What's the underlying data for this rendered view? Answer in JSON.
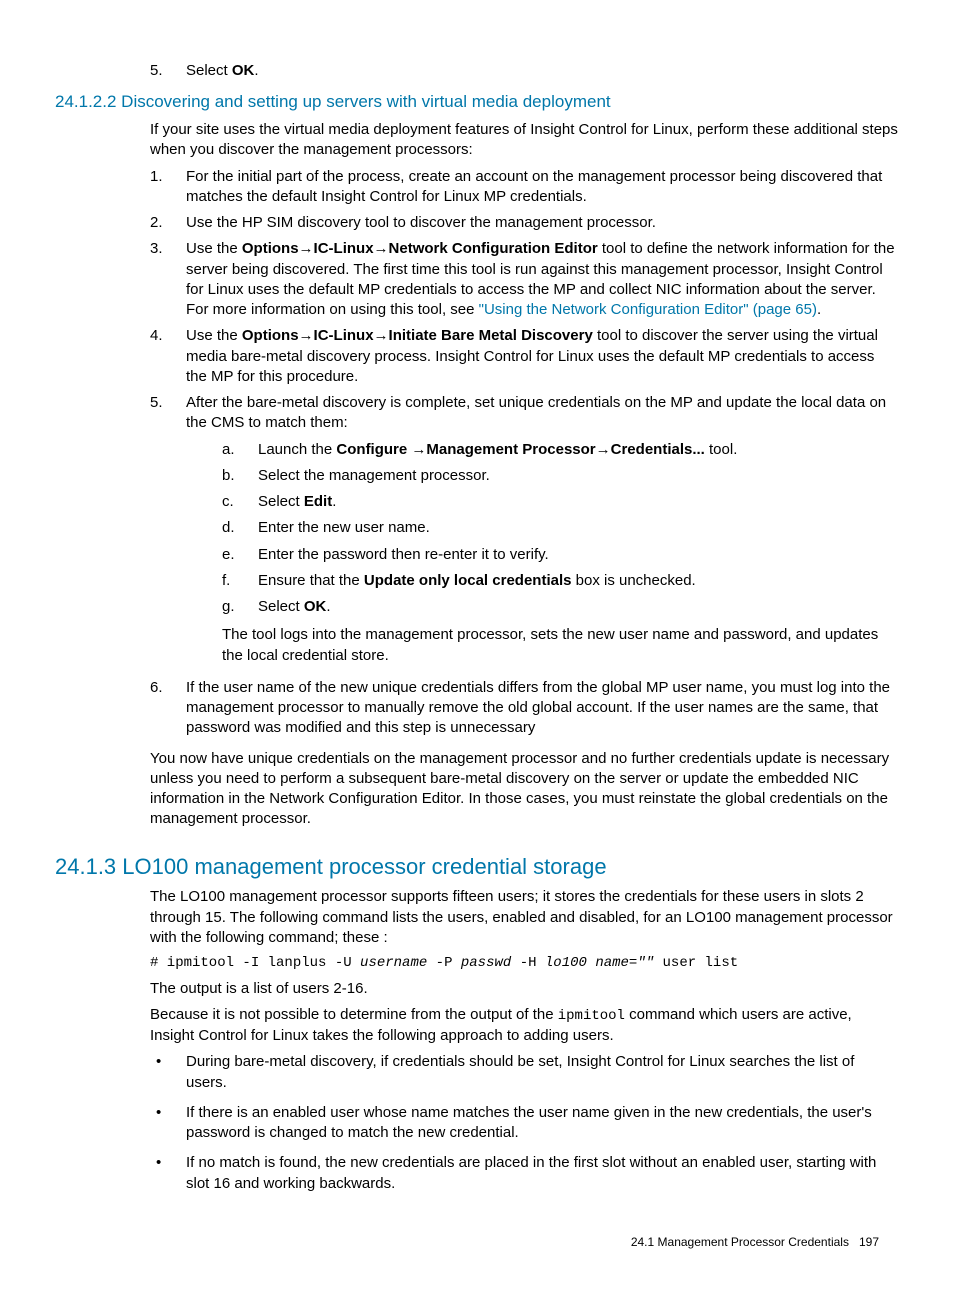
{
  "intro_list": {
    "item5": {
      "marker": "5.",
      "text_pre": "Select ",
      "bold": "OK",
      "text_post": "."
    }
  },
  "sec_24_1_2_2": {
    "heading": "24.1.2.2 Discovering and setting up servers with virtual media deployment",
    "p1": "If your site uses the virtual media deployment features of Insight Control for Linux, perform these additional steps when you discover the management processors:",
    "list": {
      "i1": {
        "marker": "1.",
        "text": "For the initial part of the process, create an account on the management processor being discovered that matches the default Insight Control for Linux MP credentials."
      },
      "i2": {
        "marker": "2.",
        "text": "Use the HP SIM discovery tool to discover the management processor."
      },
      "i3": {
        "marker": "3.",
        "seg1": "Use the ",
        "b1": "Options",
        "arrow1": "→",
        "b2": "IC-Linux",
        "arrow2": "→",
        "b3": "Network Configuration Editor",
        "seg2": " tool to define the network information for the server being discovered. The first time this tool is run against this management processor, Insight Control for Linux uses the default MP credentials to access the MP and collect NIC information about the server. For more information on using this tool, see ",
        "link": "\"Using the Network Configuration Editor\" (page 65)",
        "seg3": "."
      },
      "i4": {
        "marker": "4.",
        "seg1": "Use the ",
        "b1": "Options",
        "arrow1": "→",
        "b2": "IC-Linux",
        "arrow2": "→",
        "b3": "Initiate Bare Metal Discovery",
        "seg2": " tool to discover the server using the virtual media bare-metal discovery process. Insight Control for Linux uses the default MP credentials to access the MP for this procedure."
      },
      "i5": {
        "marker": "5.",
        "text": "After the bare-metal discovery is complete, set unique credentials on the MP and update the local data on the CMS to match them:",
        "sub": {
          "a": {
            "marker": "a.",
            "seg1": "Launch the ",
            "b1": "Configure ",
            "arrow1": "→",
            "b2": "Management Processor",
            "arrow2": "→",
            "b3": "Credentials...",
            "seg2": " tool."
          },
          "b": {
            "marker": "b.",
            "text": "Select the management processor."
          },
          "c": {
            "marker": "c.",
            "seg1": "Select ",
            "b1": "Edit",
            "seg2": "."
          },
          "d": {
            "marker": "d.",
            "text": "Enter the new user name."
          },
          "e": {
            "marker": "e.",
            "text": "Enter the password then re-enter it to verify."
          },
          "f": {
            "marker": "f.",
            "seg1": "Ensure that the ",
            "b1": "Update only local credentials",
            "seg2": " box is unchecked."
          },
          "g": {
            "marker": "g.",
            "seg1": "Select ",
            "b1": "OK",
            "seg2": "."
          }
        },
        "after": "The tool logs into the management processor, sets the new user name and password, and updates the local credential store."
      },
      "i6": {
        "marker": "6.",
        "text": "If the user name of the new unique credentials differs from the global MP user name, you must log into the management processor to manually remove the old global account. If the user names are the same, that password was modified and this step is unnecessary"
      }
    },
    "p2": "You now have unique credentials on the management processor and no further credentials update is necessary unless you need to perform a subsequent bare-metal discovery on the server or update the embedded NIC information in the Network Configuration Editor. In those cases, you must reinstate the global credentials on the management processor."
  },
  "sec_24_1_3": {
    "heading": "24.1.3 LO100 management processor credential storage",
    "p1": "The LO100 management processor supports fifteen users; it stores the credentials for these users in slots 2 through 15. The following command lists the users, enabled and disabled, for an LO100 management processor with the following command; these :",
    "code": {
      "c1": "# ipmitool -I lanplus -U ",
      "i1": "username",
      "c2": " -P ",
      "i2": "passwd",
      "c3": " -H ",
      "i3": "lo100 name=\"\"",
      "c4": " user list"
    },
    "p2": "The output is a list of users 2-16.",
    "p3_a": "Because it is not possible to determine from the output of the ",
    "p3_code": "ipmitool",
    "p3_b": " command which users are active, Insight Control for Linux takes the following approach to adding users.",
    "bullets": {
      "b1": "During bare-metal discovery, if credentials should be set, Insight Control for Linux searches the list of users.",
      "b2": "If there is an enabled user whose name matches the user name given in the new credentials, the user's password is changed to match the new credential.",
      "b3": "If no match is found, the new credentials are placed in the first slot without an enabled user, starting with slot 16 and working backwards."
    }
  },
  "footer": {
    "section": "24.1 Management Processor Credentials",
    "page": "197"
  },
  "bullet_glyph": "•"
}
